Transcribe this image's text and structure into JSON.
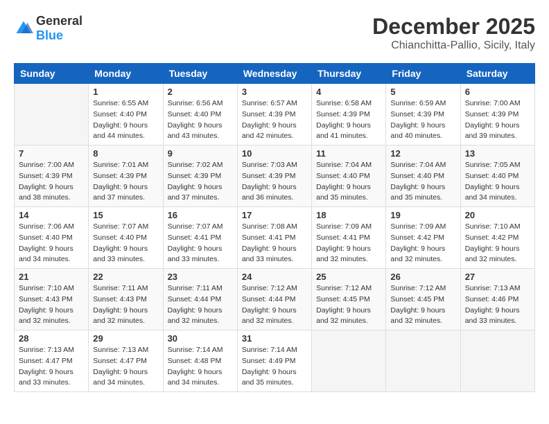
{
  "logo": {
    "text_general": "General",
    "text_blue": "Blue"
  },
  "header": {
    "month": "December 2025",
    "location": "Chianchitta-Pallio, Sicily, Italy"
  },
  "weekdays": [
    "Sunday",
    "Monday",
    "Tuesday",
    "Wednesday",
    "Thursday",
    "Friday",
    "Saturday"
  ],
  "weeks": [
    [
      {
        "day": "",
        "sunrise": "",
        "sunset": "",
        "daylight": ""
      },
      {
        "day": "1",
        "sunrise": "Sunrise: 6:55 AM",
        "sunset": "Sunset: 4:40 PM",
        "daylight": "Daylight: 9 hours and 44 minutes."
      },
      {
        "day": "2",
        "sunrise": "Sunrise: 6:56 AM",
        "sunset": "Sunset: 4:40 PM",
        "daylight": "Daylight: 9 hours and 43 minutes."
      },
      {
        "day": "3",
        "sunrise": "Sunrise: 6:57 AM",
        "sunset": "Sunset: 4:39 PM",
        "daylight": "Daylight: 9 hours and 42 minutes."
      },
      {
        "day": "4",
        "sunrise": "Sunrise: 6:58 AM",
        "sunset": "Sunset: 4:39 PM",
        "daylight": "Daylight: 9 hours and 41 minutes."
      },
      {
        "day": "5",
        "sunrise": "Sunrise: 6:59 AM",
        "sunset": "Sunset: 4:39 PM",
        "daylight": "Daylight: 9 hours and 40 minutes."
      },
      {
        "day": "6",
        "sunrise": "Sunrise: 7:00 AM",
        "sunset": "Sunset: 4:39 PM",
        "daylight": "Daylight: 9 hours and 39 minutes."
      }
    ],
    [
      {
        "day": "7",
        "sunrise": "Sunrise: 7:00 AM",
        "sunset": "Sunset: 4:39 PM",
        "daylight": "Daylight: 9 hours and 38 minutes."
      },
      {
        "day": "8",
        "sunrise": "Sunrise: 7:01 AM",
        "sunset": "Sunset: 4:39 PM",
        "daylight": "Daylight: 9 hours and 37 minutes."
      },
      {
        "day": "9",
        "sunrise": "Sunrise: 7:02 AM",
        "sunset": "Sunset: 4:39 PM",
        "daylight": "Daylight: 9 hours and 37 minutes."
      },
      {
        "day": "10",
        "sunrise": "Sunrise: 7:03 AM",
        "sunset": "Sunset: 4:39 PM",
        "daylight": "Daylight: 9 hours and 36 minutes."
      },
      {
        "day": "11",
        "sunrise": "Sunrise: 7:04 AM",
        "sunset": "Sunset: 4:40 PM",
        "daylight": "Daylight: 9 hours and 35 minutes."
      },
      {
        "day": "12",
        "sunrise": "Sunrise: 7:04 AM",
        "sunset": "Sunset: 4:40 PM",
        "daylight": "Daylight: 9 hours and 35 minutes."
      },
      {
        "day": "13",
        "sunrise": "Sunrise: 7:05 AM",
        "sunset": "Sunset: 4:40 PM",
        "daylight": "Daylight: 9 hours and 34 minutes."
      }
    ],
    [
      {
        "day": "14",
        "sunrise": "Sunrise: 7:06 AM",
        "sunset": "Sunset: 4:40 PM",
        "daylight": "Daylight: 9 hours and 34 minutes."
      },
      {
        "day": "15",
        "sunrise": "Sunrise: 7:07 AM",
        "sunset": "Sunset: 4:40 PM",
        "daylight": "Daylight: 9 hours and 33 minutes."
      },
      {
        "day": "16",
        "sunrise": "Sunrise: 7:07 AM",
        "sunset": "Sunset: 4:41 PM",
        "daylight": "Daylight: 9 hours and 33 minutes."
      },
      {
        "day": "17",
        "sunrise": "Sunrise: 7:08 AM",
        "sunset": "Sunset: 4:41 PM",
        "daylight": "Daylight: 9 hours and 33 minutes."
      },
      {
        "day": "18",
        "sunrise": "Sunrise: 7:09 AM",
        "sunset": "Sunset: 4:41 PM",
        "daylight": "Daylight: 9 hours and 32 minutes."
      },
      {
        "day": "19",
        "sunrise": "Sunrise: 7:09 AM",
        "sunset": "Sunset: 4:42 PM",
        "daylight": "Daylight: 9 hours and 32 minutes."
      },
      {
        "day": "20",
        "sunrise": "Sunrise: 7:10 AM",
        "sunset": "Sunset: 4:42 PM",
        "daylight": "Daylight: 9 hours and 32 minutes."
      }
    ],
    [
      {
        "day": "21",
        "sunrise": "Sunrise: 7:10 AM",
        "sunset": "Sunset: 4:43 PM",
        "daylight": "Daylight: 9 hours and 32 minutes."
      },
      {
        "day": "22",
        "sunrise": "Sunrise: 7:11 AM",
        "sunset": "Sunset: 4:43 PM",
        "daylight": "Daylight: 9 hours and 32 minutes."
      },
      {
        "day": "23",
        "sunrise": "Sunrise: 7:11 AM",
        "sunset": "Sunset: 4:44 PM",
        "daylight": "Daylight: 9 hours and 32 minutes."
      },
      {
        "day": "24",
        "sunrise": "Sunrise: 7:12 AM",
        "sunset": "Sunset: 4:44 PM",
        "daylight": "Daylight: 9 hours and 32 minutes."
      },
      {
        "day": "25",
        "sunrise": "Sunrise: 7:12 AM",
        "sunset": "Sunset: 4:45 PM",
        "daylight": "Daylight: 9 hours and 32 minutes."
      },
      {
        "day": "26",
        "sunrise": "Sunrise: 7:12 AM",
        "sunset": "Sunset: 4:45 PM",
        "daylight": "Daylight: 9 hours and 32 minutes."
      },
      {
        "day": "27",
        "sunrise": "Sunrise: 7:13 AM",
        "sunset": "Sunset: 4:46 PM",
        "daylight": "Daylight: 9 hours and 33 minutes."
      }
    ],
    [
      {
        "day": "28",
        "sunrise": "Sunrise: 7:13 AM",
        "sunset": "Sunset: 4:47 PM",
        "daylight": "Daylight: 9 hours and 33 minutes."
      },
      {
        "day": "29",
        "sunrise": "Sunrise: 7:13 AM",
        "sunset": "Sunset: 4:47 PM",
        "daylight": "Daylight: 9 hours and 34 minutes."
      },
      {
        "day": "30",
        "sunrise": "Sunrise: 7:14 AM",
        "sunset": "Sunset: 4:48 PM",
        "daylight": "Daylight: 9 hours and 34 minutes."
      },
      {
        "day": "31",
        "sunrise": "Sunrise: 7:14 AM",
        "sunset": "Sunset: 4:49 PM",
        "daylight": "Daylight: 9 hours and 35 minutes."
      },
      {
        "day": "",
        "sunrise": "",
        "sunset": "",
        "daylight": ""
      },
      {
        "day": "",
        "sunrise": "",
        "sunset": "",
        "daylight": ""
      },
      {
        "day": "",
        "sunrise": "",
        "sunset": "",
        "daylight": ""
      }
    ]
  ]
}
